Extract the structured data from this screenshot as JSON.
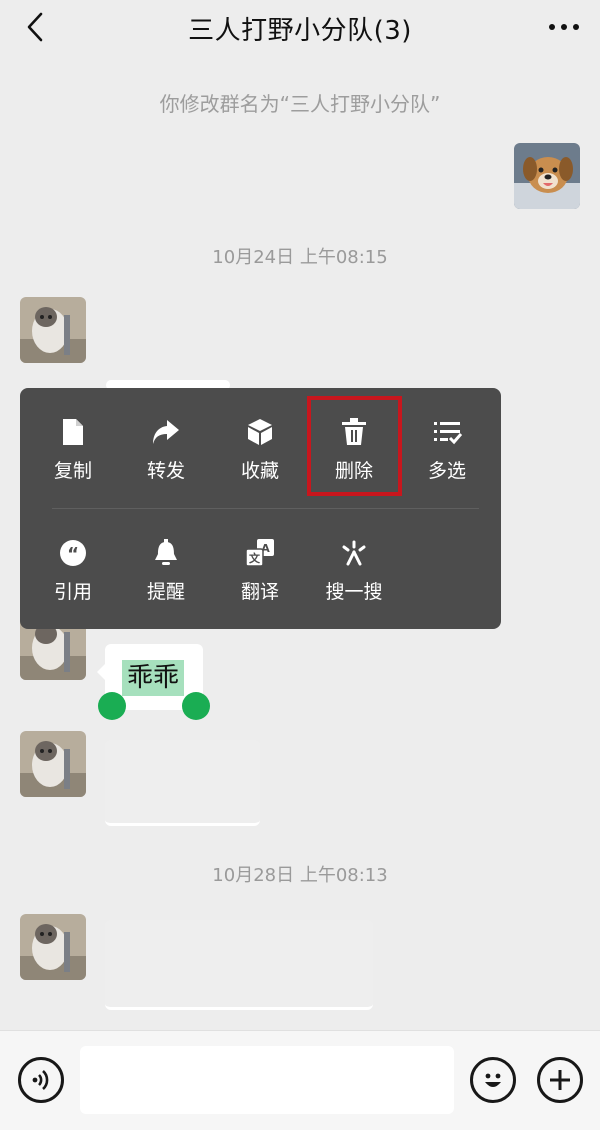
{
  "header": {
    "title": "三人打野小分队(3)"
  },
  "system_notice": "你修改群名为“三人打野小分队”",
  "timestamps": [
    "10月24日 上午08:15",
    "10月28日 上午08:13"
  ],
  "context_menu": {
    "row1": [
      {
        "label": "复制",
        "icon": "copy-icon"
      },
      {
        "label": "转发",
        "icon": "forward-icon"
      },
      {
        "label": "收藏",
        "icon": "favorite-icon"
      },
      {
        "label": "删除",
        "icon": "trash-icon"
      },
      {
        "label": "多选",
        "icon": "multi-select-icon"
      }
    ],
    "row2": [
      {
        "label": "引用",
        "icon": "quote-icon"
      },
      {
        "label": "提醒",
        "icon": "bell-icon"
      },
      {
        "label": "翻译",
        "icon": "translate-icon"
      },
      {
        "label": "搜一搜",
        "icon": "search-spark-icon"
      }
    ],
    "highlighted": "删除",
    "highlight_color": "#c8161d"
  },
  "selected_message": "乖乖",
  "colors": {
    "background": "#ededed",
    "menu": "#4c4c4c",
    "selection": "#a6e0bd",
    "handle": "#1aad53"
  }
}
